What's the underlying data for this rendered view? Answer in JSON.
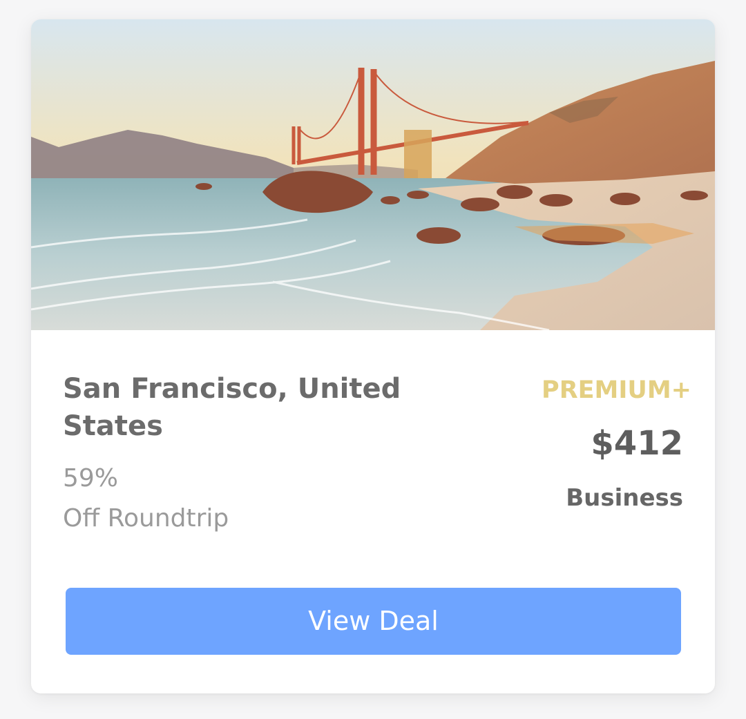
{
  "card": {
    "image_subject": "Golden Gate Bridge over beach at sunset",
    "destination": "San Francisco, United States",
    "discount_percent": "59%",
    "discount_label": "Off Roundtrip",
    "tier": "PREMIUM+",
    "price": "$412",
    "cabin_class": "Business",
    "cta_label": "View Deal"
  },
  "colors": {
    "tier": "#e4cf82",
    "cta_background": "#6ea4ff",
    "title_text": "#6b6b6b",
    "muted_text": "#9a9a9a"
  }
}
